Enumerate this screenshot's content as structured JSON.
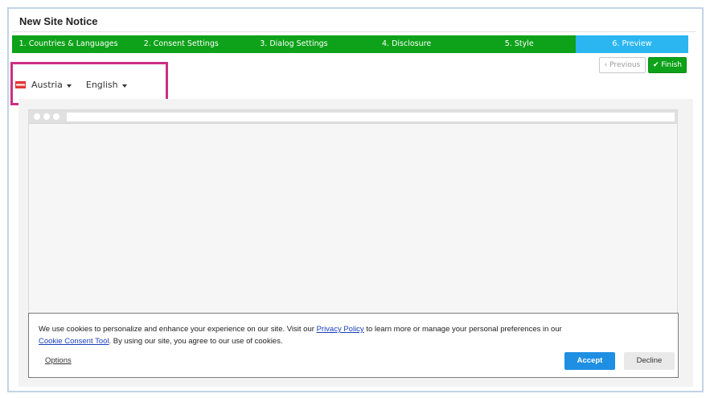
{
  "page": {
    "title": "New Site Notice"
  },
  "steps": [
    {
      "label": "1. Countries & Languages"
    },
    {
      "label": "2. Consent Settings"
    },
    {
      "label": "3. Dialog Settings"
    },
    {
      "label": "4. Disclosure"
    },
    {
      "label": "5. Style"
    },
    {
      "label": "6. Preview",
      "active": true
    }
  ],
  "nav": {
    "previous_label": "Previous",
    "finish_label": "Finish"
  },
  "selectors": {
    "country": "Austria",
    "language": "English"
  },
  "cookie_banner": {
    "text_part1": "We use cookies to personalize and enhance your experience on our site. Visit our ",
    "privacy_link": "Privacy Policy",
    "text_part2": " to learn more or manage your personal preferences in our ",
    "tool_link": "Cookie Consent Tool",
    "text_part3": ". By using our site, you agree to our use of cookies.",
    "options_label": "Options",
    "accept_label": "Accept",
    "decline_label": "Decline"
  },
  "colors": {
    "step_green": "#0ea21a",
    "step_active": "#2bb6f2",
    "highlight": "#cc2f86",
    "accept_blue": "#1e8fe3"
  }
}
